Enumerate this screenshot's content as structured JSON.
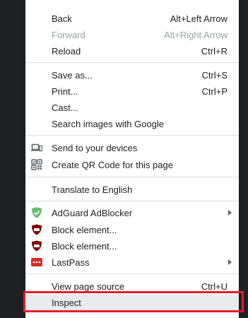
{
  "menu": {
    "items": [
      {
        "label": "Back",
        "shortcut": "Alt+Left Arrow"
      },
      {
        "label": "Forward",
        "shortcut": "Alt+Right Arrow",
        "disabled": true
      },
      {
        "label": "Reload",
        "shortcut": "Ctrl+R"
      },
      {
        "label": "Save as...",
        "shortcut": "Ctrl+S"
      },
      {
        "label": "Print...",
        "shortcut": "Ctrl+P"
      },
      {
        "label": "Cast..."
      },
      {
        "label": "Search images with Google"
      },
      {
        "label": "Send to your devices",
        "icon": "devices-icon"
      },
      {
        "label": "Create QR Code for this page",
        "icon": "qr-code-icon"
      },
      {
        "label": "Translate to English"
      },
      {
        "label": "AdGuard AdBlocker",
        "icon": "adguard-shield-icon",
        "submenu": true
      },
      {
        "label": "Block element...",
        "icon": "ublock-icon"
      },
      {
        "label": "Block element...",
        "icon": "ublock-icon"
      },
      {
        "label": "LastPass",
        "icon": "lastpass-icon",
        "submenu": true
      },
      {
        "label": "View page source",
        "shortcut": "Ctrl+U"
      },
      {
        "label": "Inspect"
      }
    ]
  },
  "colors": {
    "highlight_border": "#e01e2a",
    "adguard_green": "#68bc71",
    "ublock_red": "#800000",
    "lastpass_red": "#d32d27"
  }
}
